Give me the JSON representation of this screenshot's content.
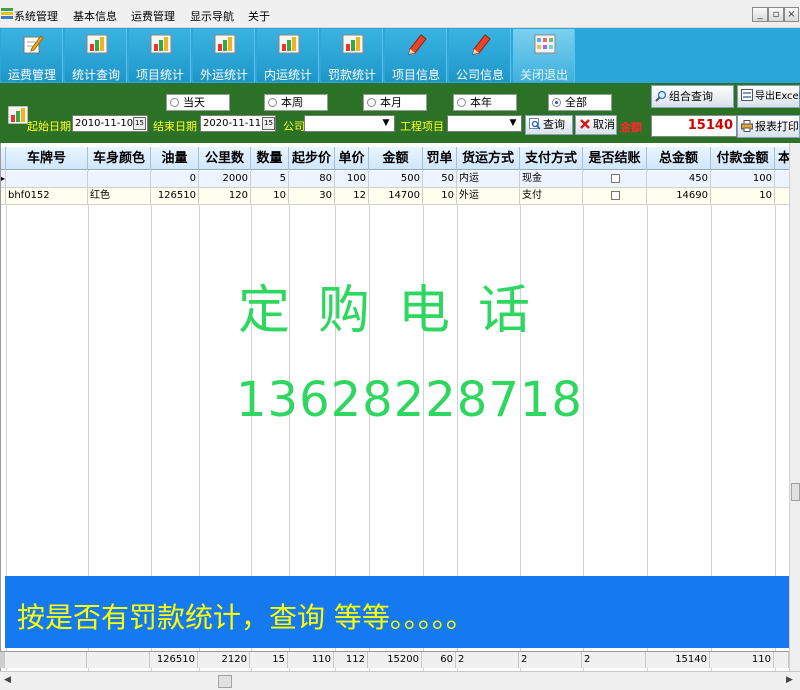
{
  "menu": {
    "items": [
      "系统管理",
      "基本信息",
      "运费管理",
      "显示导航",
      "关于"
    ],
    "window_buttons": [
      "_",
      "▫",
      "×"
    ]
  },
  "toolbar": {
    "buttons": [
      {
        "label": "运费管理",
        "icon": "pencil-notepad-icon"
      },
      {
        "label": "统计查询",
        "icon": "bar-chart-icon"
      },
      {
        "label": "项目统计",
        "icon": "bar-chart-icon"
      },
      {
        "label": "外运统计",
        "icon": "bar-chart-icon"
      },
      {
        "label": "内运统计",
        "icon": "bar-chart-icon"
      },
      {
        "label": "罚款统计",
        "icon": "bar-chart-icon"
      },
      {
        "label": "项目信息",
        "icon": "pencil-icon"
      },
      {
        "label": "公司信息",
        "icon": "pencil-icon"
      },
      {
        "label": "关闭退出",
        "icon": "grid-window-icon"
      }
    ]
  },
  "filter": {
    "radios": [
      {
        "label": "当天",
        "selected": false
      },
      {
        "label": "本周",
        "selected": false
      },
      {
        "label": "本月",
        "selected": false
      },
      {
        "label": "本年",
        "selected": false
      },
      {
        "label": "全部",
        "selected": true
      }
    ],
    "start_label": "起始日期",
    "start_value": "2010-11-10",
    "end_label": "结束日期",
    "end_value": "2020-11-11",
    "company_label": "公司",
    "company_value": "",
    "project_label": "工程项目",
    "project_value": "",
    "query_button": "查询",
    "cancel_button": "取消",
    "amount_label": "金额",
    "combo_query_button": "组合查询",
    "export_button": "导出Excel",
    "print_button": "报表打印",
    "total_value": "15140",
    "calendar_glyph": "15"
  },
  "grid": {
    "headers": [
      "车牌号",
      "车身颜色",
      "油量",
      "公里数",
      "数量",
      "起步价",
      "单价",
      "金额",
      "罚单",
      "货运方式",
      "支付方式",
      "是否结账",
      "总金额",
      "付款金额",
      "本"
    ],
    "rows": [
      [
        "",
        "",
        "0",
        "2000",
        "5",
        "80",
        "100",
        "500",
        "50",
        "内运",
        "现金",
        "",
        "450",
        "100",
        ""
      ],
      [
        "bhf0152",
        "红色",
        "126510",
        "120",
        "10",
        "30",
        "12",
        "14700",
        "10",
        "外运",
        "支付",
        "",
        "14690",
        "10",
        ""
      ]
    ],
    "totals": [
      "",
      "",
      "126510",
      "2120",
      "15",
      "110",
      "112",
      "15200",
      "60",
      "2",
      "2",
      "2",
      "15140",
      "110",
      ""
    ],
    "row_marker": "▸"
  },
  "watermark": {
    "line1": "定购电话",
    "line2": "13628228718"
  },
  "banner": {
    "text": "按是否有罚款统计，查询 等等。。。。。"
  },
  "colors": {
    "toolbar": "#2aa7d8",
    "filter_panel": "#2b7227",
    "label_yellow": "#ffff22",
    "watermark_green": "#2fd760",
    "banner_blue": "#1579ef",
    "banner_text": "#ffff00",
    "total_red": "#d10000"
  }
}
